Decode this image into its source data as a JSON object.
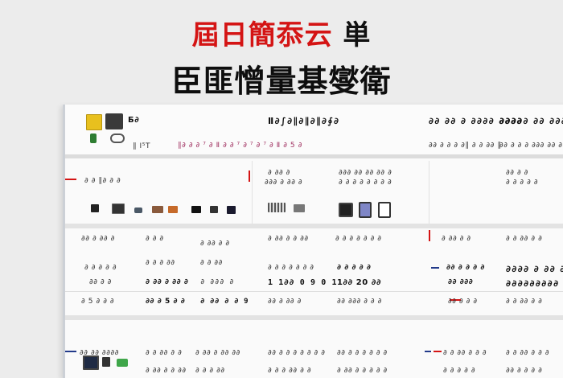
{
  "titles": {
    "line1_red": "屆日簡忝云",
    "line1_black": "単",
    "line2": "臣匪憎量基燮衛"
  },
  "header": {
    "brand": "Б∂",
    "col_sub": "∥ I⁵T",
    "col2_title": "Ⅱ∂∫∂∥∂∥∂∥∂∮∂",
    "col2_sub": "∥∂ ∂ ∂ ⁷ ∂  Ⅱ ∂ ∂ ⁷ ∂ ⁷ ∂ ⁷ ∂ Ⅱ ∂ 5 ∂",
    "col3_title": "∂∂ ∂∂ ∂ ∂∂∂∂ ∂∂∂∂",
    "col3_sub": "∂∂ ∂ ∂ ∂  ∂∥ ∂ ∂ ∂∂ ∥",
    "col4_title": "∂∂∂∂∂ ∂∂ ∂∂∂∂ Ⅱ",
    "col4_sub": "∂∂ ∂ ∂ ∂ ∂∂∂ ∂∂ ∂∂ ∂ ∥"
  },
  "section1": {
    "label_left": "∂ ∂ ∥∂ ∂ ∂",
    "label_mid": "∂ ∂∂ ∂",
    "sub_mid": "∂∂∂ ∂ ∂∂ ∂",
    "label_mid2": "∂∂∂ ∂∂ ∂∂ ∂∂ ∂",
    "sub_mid2": "∂ ∂ ∂ ∂ ∂ ∂ ∂ ∂",
    "label_right": "∂∂ ∂ ∂",
    "sub_right": "∂ ∂ ∂ ∂ ∂"
  },
  "rows": [
    {
      "a": "∂∂ ∂ ∂∂ ∂",
      "b": "∂ ∂ ∂",
      "c": "∂ ∂∂ ∂ ∂",
      "d": "∂ ∂∂ ∂ ∂ ∂∂",
      "e": "∂ ∂ ∂ ∂ ∂ ∂ ∂",
      "f": "∂ ∂∂ ∂ ∂",
      "g": "∂ ∂ ∂∂ ∂ ∂"
    },
    {
      "a": "∂ ∂ ∂ ∂ ∂",
      "b": "∂ ∂ ∂ ∂∂",
      "c": "∂ ∂ ∂∂",
      "d": "∂ ∂ ∂ ∂ ∂ ∂ ∂",
      "e": "∂ ∂ ∂ ∂ ∂",
      "f": "∂∂ ∂ ∂ ∂ ∂",
      "g": "∂∂∂∂ ∂ ∂∂ ∂ ∂"
    },
    {
      "a": "∂∂ ∂ ∂",
      "b": "∂ ∂∂ ∂ ∂∂ ∂",
      "c": "∂ ∂∂∂ ∂",
      "d": "1 1∂∂ 0 9 0 1",
      "e": "1∂∂ 20 ∂∂",
      "f": "∂∂ ∂∂∂",
      "g": "∂∂∂∂∂∂∂∂∂ ∂"
    },
    {
      "a": "∂ 5 ∂ ∂ ∂",
      "b": "∂∂ ∂ 5 ∂ ∂",
      "c": "∂ ∂∂ ∂ ∂ 9",
      "d": "∂∂ ∂ ∂∂ ∂",
      "e": "∂∂ ∂∂∂ ∂ ∂ ∂",
      "f": "∂∂ ∂ ∂ ∂",
      "g": "∂ ∂ ∂∂ ∂ ∂"
    },
    {
      "a": "∂∂ ∂∂ ∂∂∂∂",
      "b": "∂ ∂ ∂∂ ∂ ∂",
      "c": "∂ ∂∂ ∂ ∂∂ ∂∂",
      "d": "∂∂ ∂ ∂ ∂ ∂ ∂ ∂ ∂",
      "e": "∂∂ ∂ ∂ ∂ ∂ ∂ ∂",
      "f": "∂ ∂ ∂∂ ∂ ∂ ∂",
      "g": "∂ ∂ ∂∂ ∂ ∂ ∂"
    },
    {
      "a": "∂∂∂ ∂",
      "b": "∂ ∂∂ ∂ ∂ ∂∂",
      "c": "∂ ∂ ∂ ∂∂",
      "d": "∂ ∂ ∂ ∂∂ ∂ ∂",
      "e": "∂ ∂∂ ∂ ∂ ∂ ∂ ∂",
      "f": "∂ ∂ ∂ ∂ ∂",
      "g": "∂∂ ∂ ∂ ∂ ∂"
    }
  ],
  "colors": {
    "accent_red": "#d41414",
    "accent_blue": "#223a8a",
    "header_bg": "#fbfbfb"
  }
}
